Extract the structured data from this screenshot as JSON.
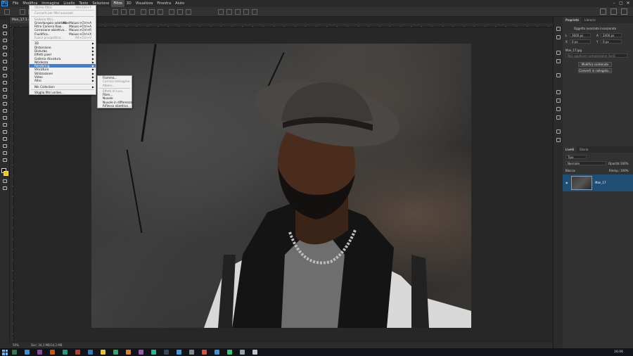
{
  "menubar": {
    "items": [
      "File",
      "Modifica",
      "Immagine",
      "Livello",
      "Testo",
      "Selezione",
      "Filtro",
      "3D",
      "Visualizza",
      "Finestra",
      "Aiuto"
    ],
    "active_index": 6
  },
  "document": {
    "tab_title": "Man_17.1 @ 50% (Man_17, RGB/8)",
    "zoom": "50%",
    "doc_info": "Doc: 34,3 MB/34,3 MB"
  },
  "filter_menu": {
    "items": [
      {
        "label": "Ultimo filtro",
        "shortcut": "Alt+Ctrl+F",
        "disabled": true
      },
      {
        "sep": true
      },
      {
        "label": "Converti per filtri avanzati",
        "disabled": true
      },
      {
        "sep": true
      },
      {
        "label": "Galleria filtri...",
        "disabled": true
      },
      {
        "label": "Grandangolo adattato...",
        "shortcut": "Alt+Maiusc+Ctrl+A"
      },
      {
        "label": "Filtro Camera Raw...",
        "shortcut": "Maiusc+Ctrl+A"
      },
      {
        "label": "Correzione obiettivo...",
        "shortcut": "Maiusc+Ctrl+R"
      },
      {
        "label": "Fluidifica...",
        "shortcut": "Maiusc+Ctrl+X"
      },
      {
        "label": "Fuoco prospettico...",
        "shortcut": "Alt+Ctrl+V",
        "disabled": true
      },
      {
        "sep": true
      },
      {
        "label": "3D",
        "submenu": true
      },
      {
        "label": "Distorsione",
        "submenu": true
      },
      {
        "label": "Disturbo",
        "submenu": true
      },
      {
        "label": "Effetti pixel",
        "submenu": true
      },
      {
        "label": "Galleria sfocatura",
        "submenu": true
      },
      {
        "label": "Nitidezza",
        "submenu": true
      },
      {
        "label": "Rendering",
        "submenu": true,
        "highlighted": true
      },
      {
        "label": "Sfocatura",
        "submenu": true
      },
      {
        "label": "Stilizzazione",
        "submenu": true
      },
      {
        "label": "Video",
        "submenu": true
      },
      {
        "label": "Altro",
        "submenu": true
      },
      {
        "sep": true
      },
      {
        "label": "Nik Collection",
        "submenu": true
      },
      {
        "sep": true
      },
      {
        "label": "Sfoglia filtri online..."
      }
    ]
  },
  "rendering_submenu": {
    "items": [
      {
        "label": "Fiamma..."
      },
      {
        "label": "Cornice immagine...",
        "disabled": true
      },
      {
        "label": "Albero...",
        "disabled": true
      },
      {
        "sep": true
      },
      {
        "label": "Effetti di luce...",
        "disabled": true
      },
      {
        "label": "Fibre..."
      },
      {
        "label": "Nuvole"
      },
      {
        "label": "Nuvole in differenza"
      },
      {
        "label": "Riflesso obiettivo..."
      }
    ]
  },
  "properties_panel": {
    "tabs": [
      "Proprietà",
      "Librerie"
    ],
    "object_label": "Oggetto avanzato incorporato",
    "w_label": "L",
    "w_value": "3600 px",
    "h_label": "A",
    "h_value": "2400 px",
    "x_label": "X",
    "x_value": "0 px",
    "y_label": "Y",
    "y_value": "0 px",
    "file_name": "Man_17.jpg",
    "comps_placeholder": "Non applicare composizione livelli",
    "edit_button": "Modifica contenuto",
    "convert_button": "Converti in collegato..."
  },
  "layers_panel": {
    "tabs": [
      "Livelli",
      "Storia"
    ],
    "kind_label": "Tipo",
    "blend_mode": "Normale",
    "opacity_label": "Opacità:",
    "opacity_value": "100%",
    "lock_label": "Blocca:",
    "fill_label": "Riemp.:",
    "fill_value": "100%",
    "layer_name": "Man_17"
  },
  "taskbar": {
    "time": "16:06",
    "app_colors": [
      "#2d7d46",
      "#3a8fd9",
      "#8e44ad",
      "#d35400",
      "#16a085",
      "#c0392b",
      "#2980b9",
      "#f1c40f",
      "#27ae60",
      "#e67e22",
      "#9b59b6",
      "#1abc9c",
      "#34495e",
      "#2fa0f0",
      "#7f8c8d",
      "#e74c3c",
      "#3498db",
      "#2ecc71",
      "#95a5a6",
      "#bdc3c7"
    ]
  }
}
